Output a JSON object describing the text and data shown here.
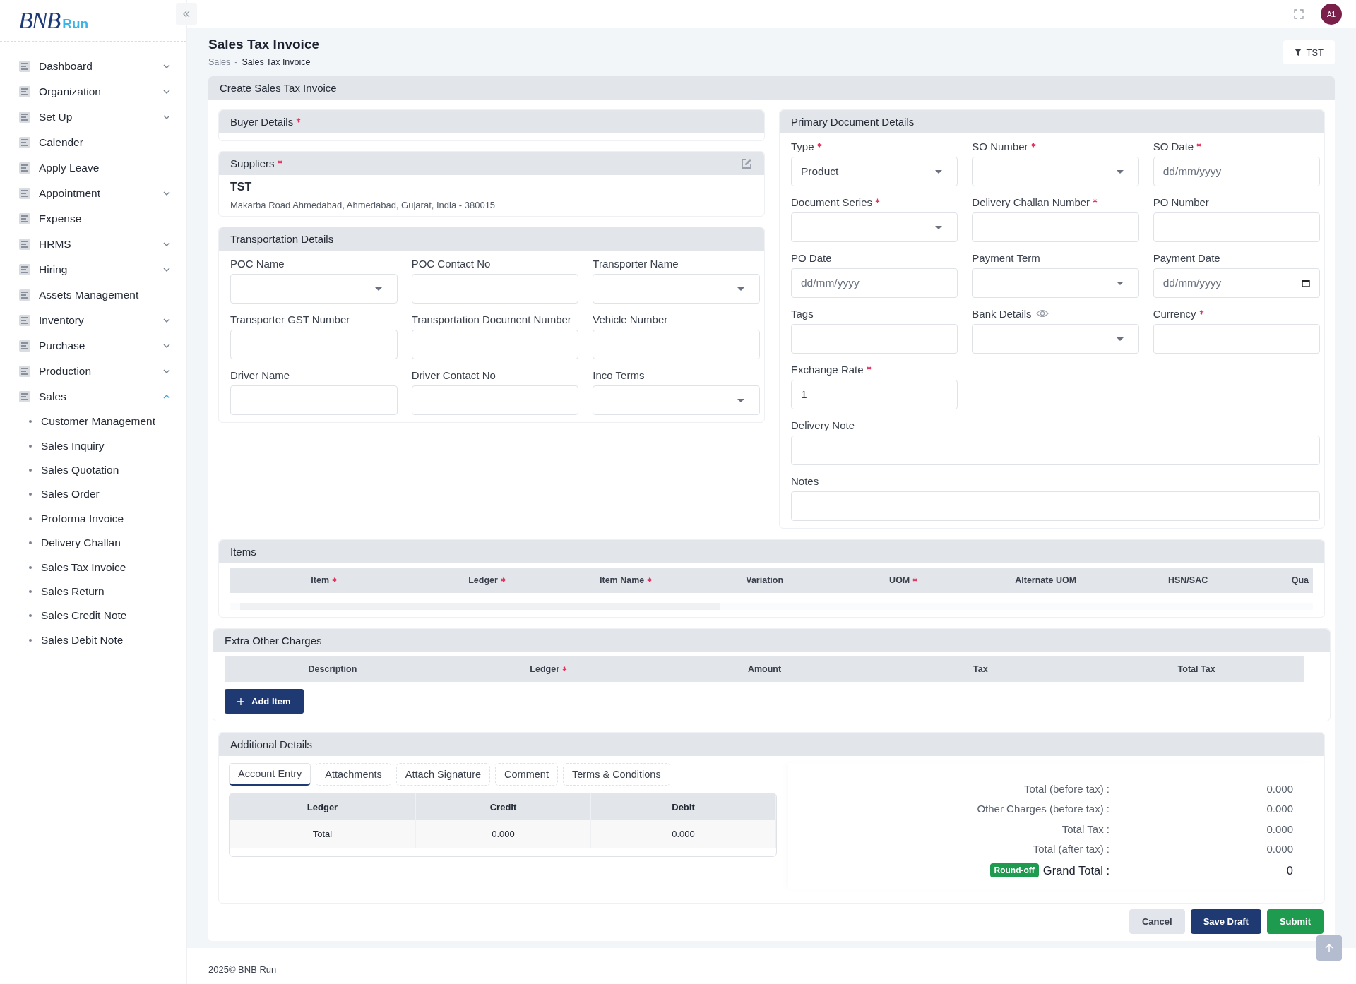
{
  "sidebar": {
    "logo": {
      "mark": "BNB",
      "name": "Run"
    },
    "items": [
      {
        "label": "Dashboard",
        "has_submenu": true,
        "expanded": false
      },
      {
        "label": "Organization",
        "has_submenu": true,
        "expanded": false
      },
      {
        "label": "Set Up",
        "has_submenu": true,
        "expanded": false
      },
      {
        "label": "Calender",
        "has_submenu": false
      },
      {
        "label": "Apply Leave",
        "has_submenu": false
      },
      {
        "label": "Appointment",
        "has_submenu": true,
        "expanded": false
      },
      {
        "label": "Expense",
        "has_submenu": false
      },
      {
        "label": "HRMS",
        "has_submenu": true,
        "expanded": false
      },
      {
        "label": "Hiring",
        "has_submenu": true,
        "expanded": false
      },
      {
        "label": "Assets Management",
        "has_submenu": false
      },
      {
        "label": "Inventory",
        "has_submenu": true,
        "expanded": false
      },
      {
        "label": "Purchase",
        "has_submenu": true,
        "expanded": false
      },
      {
        "label": "Production",
        "has_submenu": true,
        "expanded": false
      },
      {
        "label": "Sales",
        "has_submenu": true,
        "expanded": true,
        "children": [
          {
            "label": "Customer Management"
          },
          {
            "label": "Sales Inquiry"
          },
          {
            "label": "Sales Quotation"
          },
          {
            "label": "Sales Order"
          },
          {
            "label": "Proforma Invoice"
          },
          {
            "label": "Delivery Challan"
          },
          {
            "label": "Sales Tax Invoice"
          },
          {
            "label": "Sales Return"
          },
          {
            "label": "Sales Credit Note"
          },
          {
            "label": "Sales Debit Note"
          }
        ]
      }
    ]
  },
  "topbar": {
    "avatar": "A1"
  },
  "page": {
    "title": "Sales Tax Invoice",
    "breadcrumb": [
      "Sales",
      "Sales Tax Invoice"
    ],
    "breadcrumb_separator": "-",
    "filter_button": "TST"
  },
  "form": {
    "title": "Create Sales Tax Invoice",
    "buyer": {
      "title": "Buyer Details",
      "required": true
    },
    "suppliers": {
      "title": "Suppliers",
      "required": true,
      "name": "TST",
      "address": "Makarba Road Ahmedabad, Ahmedabad, Gujarat, India - 380015"
    },
    "transportation": {
      "title": "Transportation Details",
      "fields": [
        {
          "label": "POC Name",
          "required": false,
          "kind": "select"
        },
        {
          "label": "POC Contact No",
          "required": false,
          "kind": "text"
        },
        {
          "label": "Transporter Name",
          "required": false,
          "kind": "select"
        },
        {
          "label": "Transporter GST Number",
          "required": false,
          "kind": "text"
        },
        {
          "label": "Transportation Document Number",
          "required": false,
          "kind": "text"
        },
        {
          "label": "Vehicle Number",
          "required": false,
          "kind": "text"
        },
        {
          "label": "Driver Name",
          "required": false,
          "kind": "text"
        },
        {
          "label": "Driver Contact No",
          "required": false,
          "kind": "text"
        },
        {
          "label": "Inco Terms",
          "required": false,
          "kind": "select"
        }
      ]
    },
    "primary": {
      "title": "Primary Document Details",
      "fields": [
        {
          "label": "Type",
          "required": true,
          "kind": "select",
          "value": "Product"
        },
        {
          "label": "SO Number",
          "required": true,
          "kind": "select"
        },
        {
          "label": "SO Date",
          "required": true,
          "kind": "date",
          "placeholder": "dd/mm/yyyy"
        },
        {
          "label": "Document Series",
          "required": true,
          "kind": "select"
        },
        {
          "label": "Delivery Challan Number",
          "required": true,
          "kind": "text"
        },
        {
          "label": "PO Number",
          "required": false,
          "kind": "text"
        },
        {
          "label": "PO Date",
          "required": false,
          "kind": "date",
          "placeholder": "dd/mm/yyyy"
        },
        {
          "label": "Payment Term",
          "required": false,
          "kind": "select"
        },
        {
          "label": "Payment Date",
          "required": false,
          "kind": "datepicker",
          "placeholder": "dd/mm/yyyy"
        },
        {
          "label": "Tags",
          "required": false,
          "kind": "text"
        },
        {
          "label": "Bank Details",
          "required": false,
          "kind": "select",
          "info_icon": true
        },
        {
          "label": "Currency",
          "required": true,
          "kind": "text"
        },
        {
          "label": "Exchange Rate",
          "required": true,
          "kind": "text",
          "value": "1"
        },
        {
          "label": "Delivery Note",
          "required": false,
          "kind": "wide"
        },
        {
          "label": "Notes",
          "required": false,
          "kind": "wide"
        }
      ]
    },
    "items": {
      "title": "Items",
      "columns": [
        {
          "label": "Item",
          "required": true
        },
        {
          "label": "Ledger",
          "required": true
        },
        {
          "label": "Item Name",
          "required": true
        },
        {
          "label": "Variation",
          "required": false
        },
        {
          "label": "UOM",
          "required": true
        },
        {
          "label": "Alternate UOM",
          "required": false
        },
        {
          "label": "HSN/SAC",
          "required": false
        },
        {
          "label": "Qua",
          "required": false
        }
      ]
    },
    "extra_charges": {
      "title": "Extra Other Charges",
      "columns": [
        {
          "label": "Description",
          "required": false
        },
        {
          "label": "Ledger",
          "required": true
        },
        {
          "label": "Amount",
          "required": false
        },
        {
          "label": "Tax",
          "required": false
        },
        {
          "label": "Total Tax",
          "required": false
        }
      ],
      "add_button": "Add Item"
    },
    "additional": {
      "title": "Additional Details",
      "tabs": [
        {
          "label": "Account Entry",
          "selected": true
        },
        {
          "label": "Attachments",
          "selected": false
        },
        {
          "label": "Attach Signature",
          "selected": false
        },
        {
          "label": "Comment",
          "selected": false
        },
        {
          "label": "Terms & Conditions",
          "selected": false
        }
      ],
      "ledger_table": {
        "columns": [
          "Ledger",
          "Credit",
          "Debit"
        ],
        "rows": [
          [
            "Total",
            "0.000",
            "0.000"
          ]
        ]
      },
      "totals": [
        {
          "label": "Total (before tax) :",
          "value": "0.000"
        },
        {
          "label": "Other Charges (before tax) :",
          "value": "0.000"
        },
        {
          "label": "Total Tax :",
          "value": "0.000"
        },
        {
          "label": "Total (after tax) :",
          "value": "0.000"
        }
      ],
      "grand_total": {
        "badge": "Round-off",
        "label": "Grand Total :",
        "value": "0"
      }
    },
    "buttons": [
      {
        "label": "Cancel",
        "kind": "secondary"
      },
      {
        "label": "Save Draft",
        "kind": "primary"
      },
      {
        "label": "Submit",
        "kind": "success"
      }
    ]
  },
  "footer": "2025© BNB Run"
}
